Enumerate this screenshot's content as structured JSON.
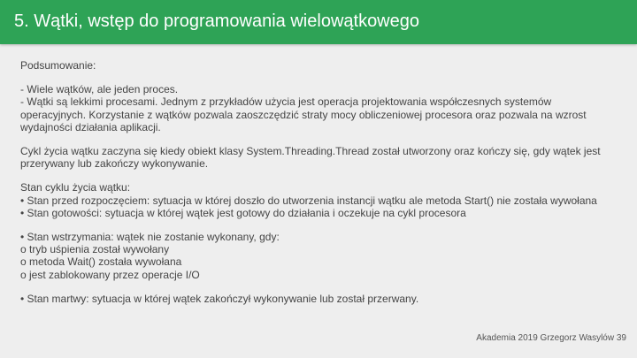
{
  "header": {
    "title": "5. Wątki, wstęp do programowania wielowątkowego",
    "color": "#2ea356"
  },
  "content": {
    "summary_heading": "Podsumowanie:",
    "summary_points": [
      "- Wiele wątków, ale jeden proces.",
      "- Wątki są lekkimi procesami. Jednym z przykładów użycia jest operacja projektowania współczesnych systemów",
      "operacyjnych. Korzystanie z wątków pozwala zaoszczędzić straty mocy obliczeniowej procesora oraz pozwala na wzrost",
      "wydajności działania aplikacji."
    ],
    "lifecycle_intro": [
      "Cykl życia wątku zaczyna się kiedy obiekt klasy System.Threading.Thread został utworzony oraz kończy się, gdy wątek jest",
      "przerywany lub zakończy wykonywanie."
    ],
    "states_heading": "Stan cyklu życia wątku:",
    "states_group1": [
      "• Stan przed rozpoczęciem: sytuacja w której doszło do utworzenia instancji wątku ale metoda Start() nie została wywołana",
      "• Stan gotowości: sytuacja w której wątek jest gotowy do działania i oczekuje na cykl procesora"
    ],
    "states_group2": [
      "• Stan wstrzymania: wątek nie zostanie wykonany, gdy:",
      "o tryb uśpienia został wywołany",
      "o metoda Wait() została wywołana",
      "o jest zablokowany przez operacje I/O"
    ],
    "states_group3": [
      "• Stan martwy: sytuacja w której wątek zakończył wykonywanie lub został przerwany."
    ]
  },
  "footer": {
    "text": "Akademia 2019 Grzegorz Wasylów 39"
  }
}
